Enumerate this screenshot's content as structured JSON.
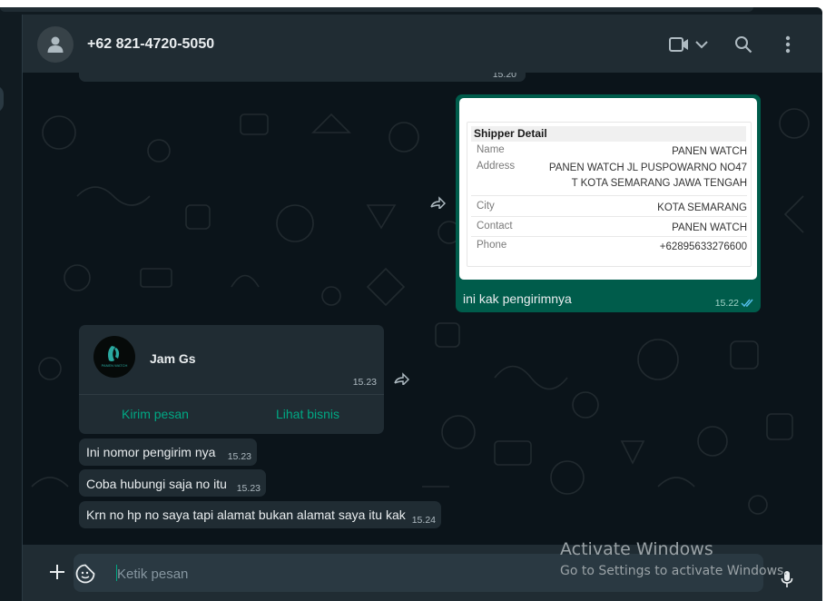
{
  "header": {
    "title": "+62 821-4720-5050",
    "icons": [
      "person-icon",
      "video-call-icon",
      "chevron-down-icon",
      "search-icon",
      "more-vertical-icon"
    ]
  },
  "messages": {
    "partial_top_time": "15.20",
    "shipper_message": {
      "card_title": "Shipper Detail",
      "rows": [
        {
          "label": "Name",
          "value": "PANEN WATCH"
        },
        {
          "label": "Address",
          "value_line1": "PANEN WATCH JL PUSPOWARNO NO47",
          "value_line2": "T KOTA SEMARANG JAWA TENGAH"
        },
        {
          "label": "City",
          "value": "KOTA SEMARANG"
        },
        {
          "label": "Contact",
          "value": "PANEN WATCH"
        },
        {
          "label": "Phone",
          "value": "+62895633276600"
        }
      ],
      "caption": "ini kak pengirimnya",
      "time": "15.22"
    },
    "business_card": {
      "name": "Jam Gs",
      "logo_text": "PANEN WATCH",
      "time": "15.23",
      "btn_message": "Kirim pesan",
      "btn_business": "Lihat bisnis"
    },
    "incoming": [
      {
        "text": "Ini nomor pengirim nya",
        "time": "15.23"
      },
      {
        "text": "Coba hubungi saja no itu",
        "time": "15.23"
      },
      {
        "text": "Krn no hp no saya tapi alamat bukan alamat saya itu kak",
        "time": "15.24"
      }
    ]
  },
  "footer": {
    "placeholder": "Ketik pesan"
  },
  "watermark": {
    "title": "Activate Windows",
    "subtitle": "Go to Settings to activate Windows."
  },
  "colors": {
    "chat_bg": "#0b141a",
    "header_bg": "#202c33",
    "incoming_bubble": "#202c33",
    "outgoing_bubble": "#005c4b",
    "accent": "#00a884",
    "read_ticks": "#53bdeb"
  }
}
